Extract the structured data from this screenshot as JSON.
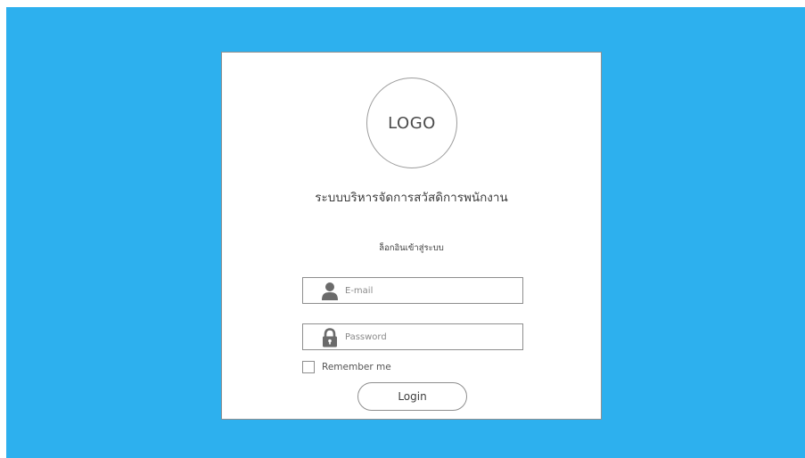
{
  "logo": {
    "text": "LOGO"
  },
  "form": {
    "title": "ระบบบริหารจัดการสวัสดิการพนักงาน",
    "subtitle": "ล็อกอินเข้าสู่ระบบ",
    "email": {
      "placeholder": "E-mail",
      "value": "",
      "icon": "user-icon"
    },
    "password": {
      "placeholder": "Password",
      "value": "",
      "icon": "lock-icon"
    },
    "remember": {
      "label": "Remember me",
      "checked": false
    },
    "submit_label": "Login"
  },
  "colors": {
    "background": "#2db0ee",
    "card": "#ffffff",
    "border": "#8e8e8e",
    "icon": "#6b6b6b",
    "text": "#3d3d3d"
  }
}
